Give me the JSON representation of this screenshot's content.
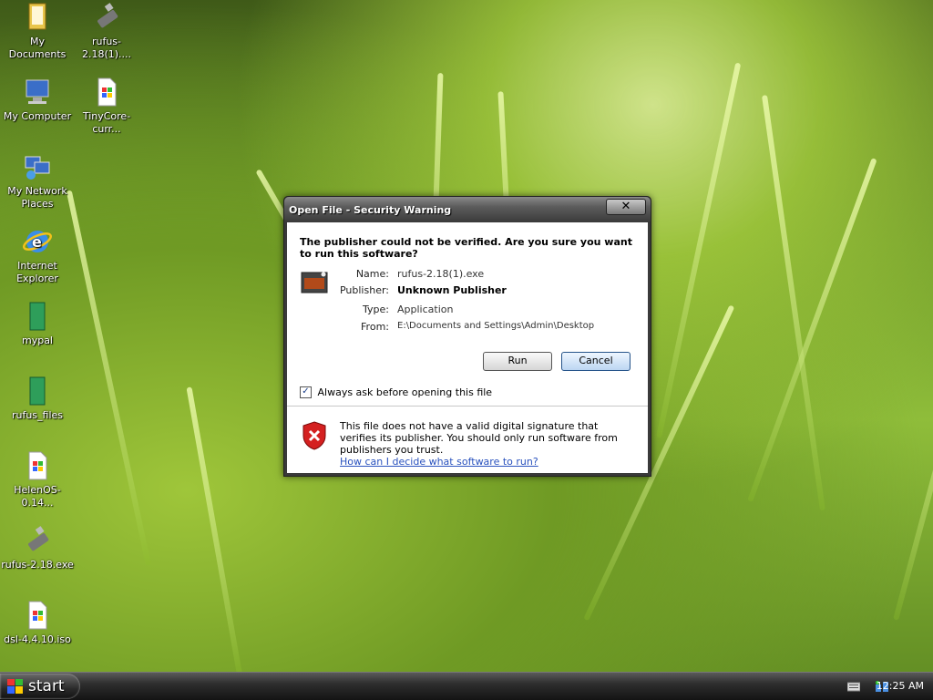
{
  "desktop": {
    "icons": [
      {
        "label": "My Documents",
        "icon": "my-documents-icon"
      },
      {
        "label": "rufus-2.18(1)....",
        "icon": "usb-drive-icon"
      },
      {
        "label": "My Computer",
        "icon": "my-computer-icon"
      },
      {
        "label": "TinyCore-curr...",
        "icon": "windows-file-icon"
      },
      {
        "label": "My Network Places",
        "icon": "network-places-icon"
      },
      {
        "label": "Internet Explorer",
        "icon": "internet-explorer-icon"
      },
      {
        "label": "mypal",
        "icon": "green-folder-icon"
      },
      {
        "label": "rufus_files",
        "icon": "green-folder-icon"
      },
      {
        "label": "HelenOS-0.14...",
        "icon": "windows-file-icon"
      },
      {
        "label": "rufus-2.18.exe",
        "icon": "usb-drive-icon"
      },
      {
        "label": "dsl-4.4.10.iso",
        "icon": "windows-file-icon"
      }
    ]
  },
  "dialog": {
    "title": "Open File - Security Warning",
    "close_label": "✕",
    "headline": "The publisher could not be verified.  Are you sure you want to run this software?",
    "fields": {
      "name_label": "Name:",
      "name_value": "rufus-2.18(1).exe",
      "publisher_label": "Publisher:",
      "publisher_value": "Unknown Publisher",
      "type_label": "Type:",
      "type_value": "Application",
      "from_label": "From:",
      "from_value": "E:\\Documents and Settings\\Admin\\Desktop"
    },
    "run_label": "Run",
    "cancel_label": "Cancel",
    "checkbox_label": "Always ask before opening this file",
    "checkbox_checked": true,
    "warning_text": "This file does not have a valid digital signature that verifies its publisher.  You should only run software from publishers you trust.",
    "help_link": "How can I decide what software to run?"
  },
  "taskbar": {
    "start_label": "start",
    "clock": "12:25 AM"
  }
}
